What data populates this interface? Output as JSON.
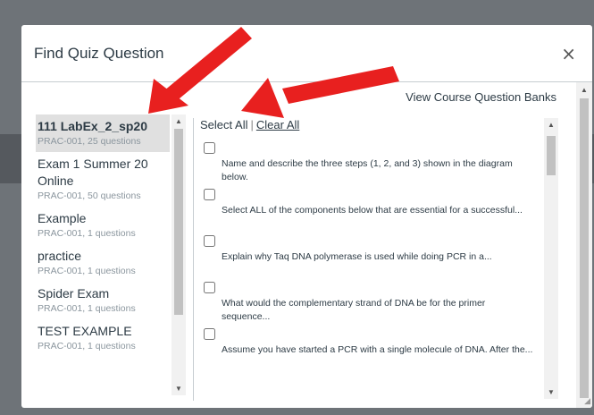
{
  "dialog": {
    "title": "Find Quiz Question",
    "close_symbol": "×",
    "view_banks_link": "View Course Question Banks",
    "select_all": "Select All",
    "separator": "|",
    "clear_all": "Clear All"
  },
  "banks": [
    {
      "name": "111 LabEx_2_sp20",
      "meta": "PRAC-001, 25 questions"
    },
    {
      "name": "Exam 1 Summer 20 Online",
      "meta": "PRAC-001, 50 questions"
    },
    {
      "name": "Example",
      "meta": "PRAC-001, 1 questions"
    },
    {
      "name": "practice",
      "meta": "PRAC-001, 1 questions"
    },
    {
      "name": "Spider Exam",
      "meta": "PRAC-001, 1 questions"
    },
    {
      "name": "TEST EXAMPLE",
      "meta": "PRAC-001, 1 questions"
    }
  ],
  "questions": [
    {
      "text": "Name and describe the three steps (1, 2, and 3) shown in the diagram below."
    },
    {
      "text": "Select ALL of the components below that are essential for a successful..."
    },
    {
      "text": "Explain why Taq DNA polymerase is used while doing PCR in a..."
    },
    {
      "text": "What would the complementary strand of DNA be for the primer sequence..."
    },
    {
      "text": "Assume you have started a PCR with a single molecule of DNA. After the..."
    }
  ],
  "colors": {
    "annotation_arrow": "#e8201f",
    "overlay": "#6e7378"
  }
}
